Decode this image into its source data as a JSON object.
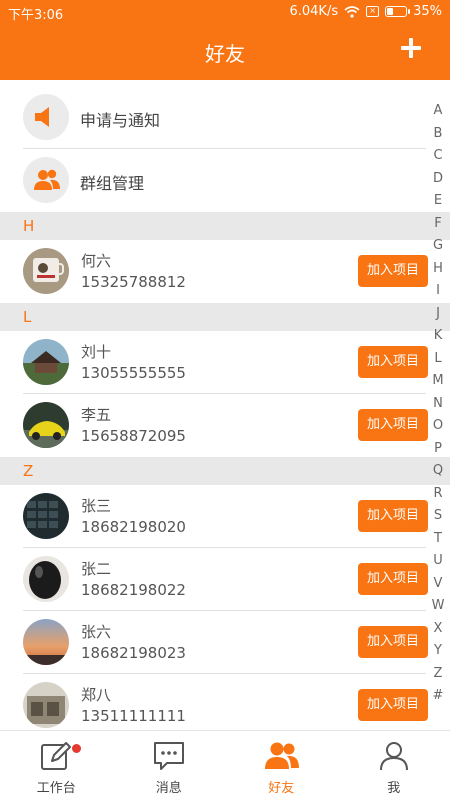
{
  "status": {
    "time": "下午3:06",
    "speed": "6.04K/s",
    "battery": "35%",
    "battery_level": 0.35
  },
  "header": {
    "title": "好友",
    "add_icon": "plus-icon"
  },
  "top_items": [
    {
      "label": "申请与通知",
      "icon": "speaker-icon"
    },
    {
      "label": "群组管理",
      "icon": "group-icon"
    }
  ],
  "sections": [
    {
      "letter": "H",
      "friends": [
        {
          "name": "何六",
          "phone": "15325788812"
        }
      ]
    },
    {
      "letter": "L",
      "friends": [
        {
          "name": "刘十",
          "phone": "13055555555"
        },
        {
          "name": "李五",
          "phone": "15658872095"
        }
      ]
    },
    {
      "letter": "Z",
      "friends": [
        {
          "name": "张三",
          "phone": "18682198020"
        },
        {
          "name": "张二",
          "phone": "18682198022"
        },
        {
          "name": "张六",
          "phone": "18682198023"
        },
        {
          "name": "郑八",
          "phone": "13511111111"
        }
      ]
    }
  ],
  "join_label": "加入项目",
  "alphabet": [
    "A",
    "B",
    "C",
    "D",
    "E",
    "F",
    "G",
    "H",
    "I",
    "J",
    "K",
    "L",
    "M",
    "N",
    "O",
    "P",
    "Q",
    "R",
    "S",
    "T",
    "U",
    "V",
    "W",
    "X",
    "Y",
    "Z",
    "#"
  ],
  "tabs": [
    {
      "label": "工作台",
      "icon": "edit-icon",
      "badge": true
    },
    {
      "label": "消息",
      "icon": "message-icon"
    },
    {
      "label": "好友",
      "icon": "friends-icon",
      "active": true
    },
    {
      "label": "我",
      "icon": "person-icon"
    }
  ],
  "colors": {
    "accent": "#f97412",
    "section_bg": "#e8e8e8",
    "badge": "#e53a2d"
  }
}
